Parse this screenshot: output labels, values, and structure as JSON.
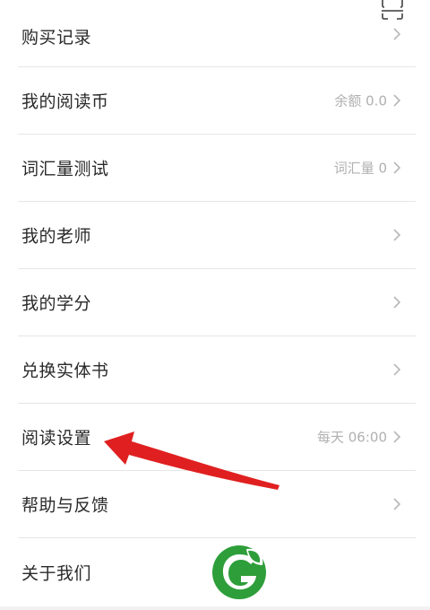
{
  "menu": {
    "items": [
      {
        "label": "购买记录",
        "value": ""
      },
      {
        "label": "我的阅读币",
        "value": "余额 0.0"
      },
      {
        "label": "词汇量测试",
        "value": "词汇量 0"
      },
      {
        "label": "我的老师",
        "value": ""
      },
      {
        "label": "我的学分",
        "value": ""
      },
      {
        "label": "兑换实体书",
        "value": ""
      },
      {
        "label": "阅读设置",
        "value": "每天 06:00"
      },
      {
        "label": "帮助与反馈",
        "value": ""
      },
      {
        "label": "关于我们",
        "value": ""
      }
    ]
  },
  "header": {
    "scan_icon": "scan-icon"
  },
  "annotation": {
    "arrow_color": "#e02020",
    "arrow_target": "阅读设置"
  },
  "watermark": {
    "logo_color": "#2e9e3a"
  },
  "colors": {
    "text": "#2a2a2a",
    "value_text": "#b0b0b0",
    "divider": "#e6e6e6",
    "chevron": "#b8b8b8"
  }
}
